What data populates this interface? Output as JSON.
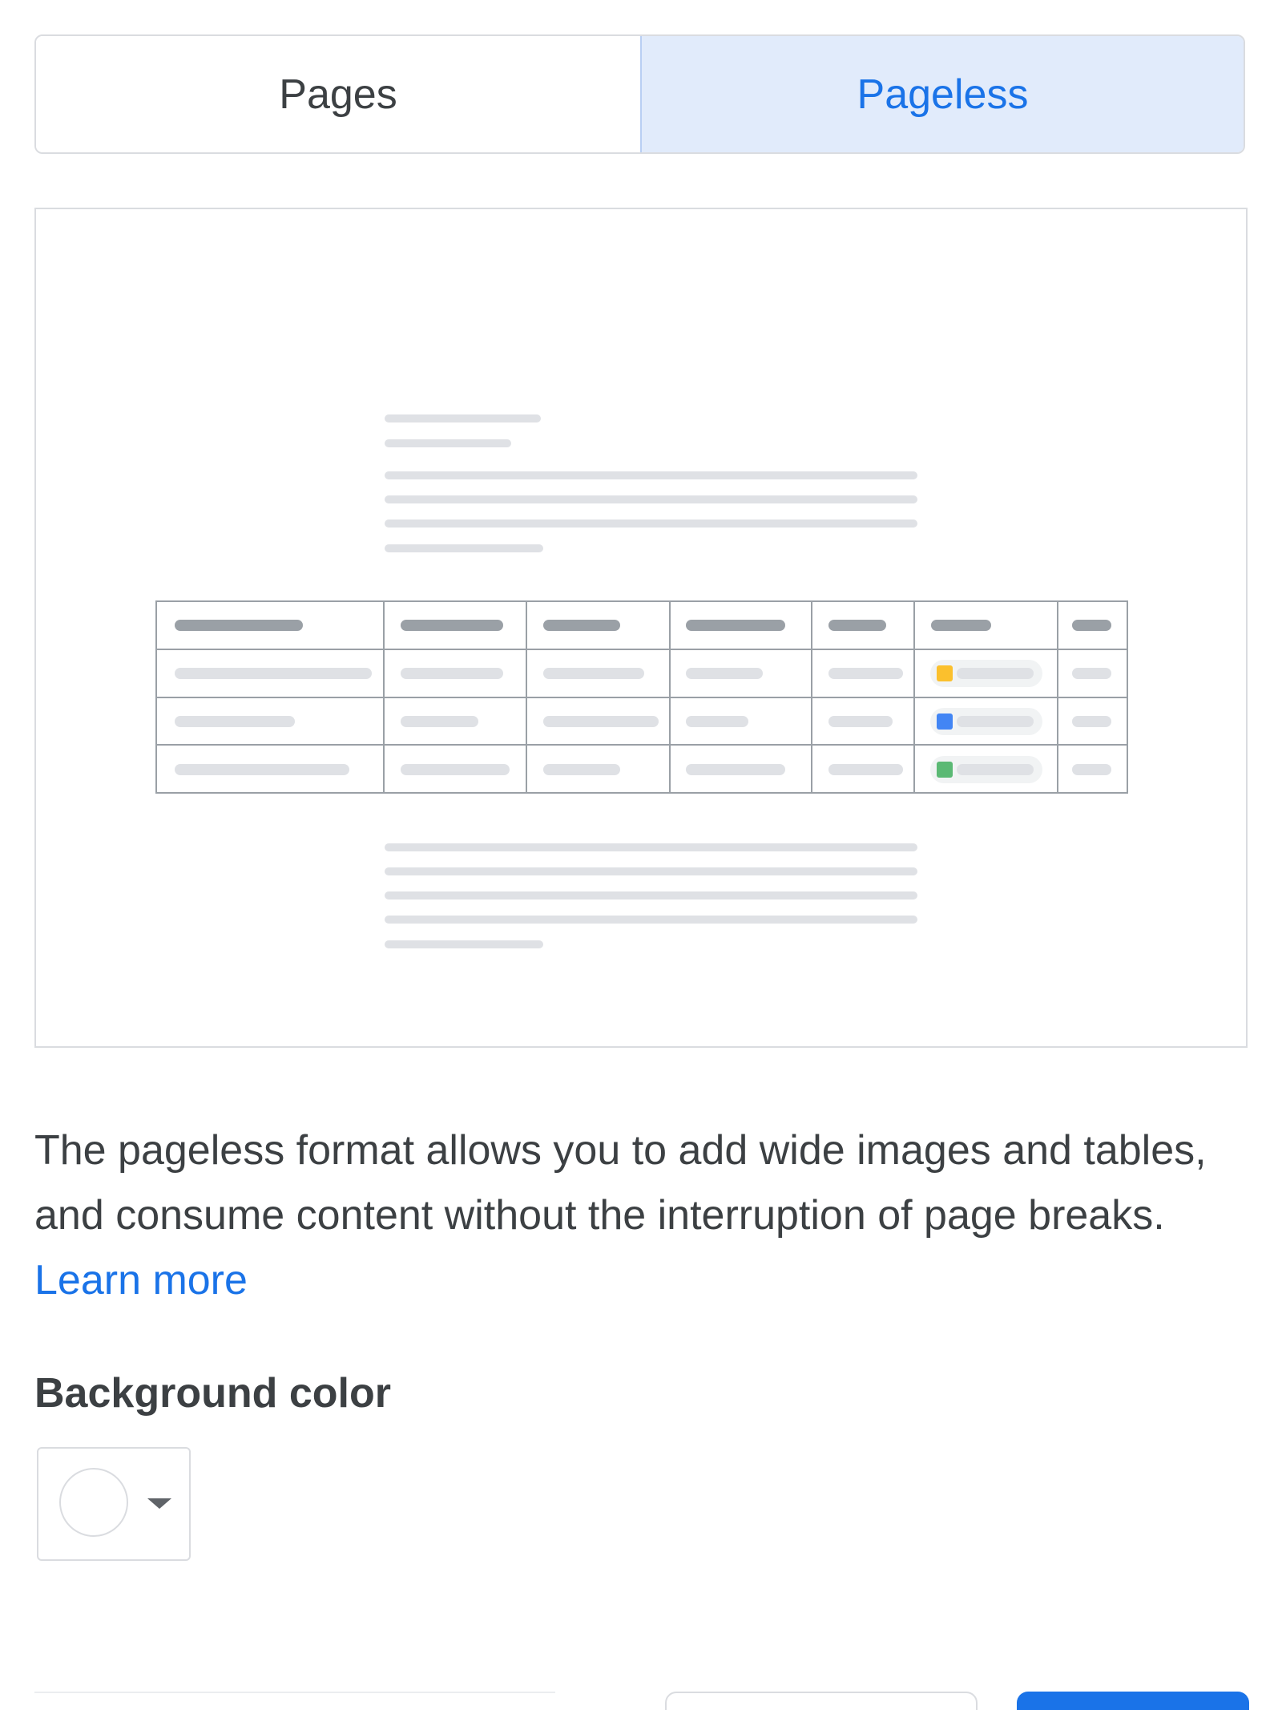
{
  "format_toggle": {
    "pages_label": "Pages",
    "pageless_label": "Pageless",
    "selected": "Pageless"
  },
  "preview": {
    "chip_colors": [
      "#fbc02d",
      "#4285f4",
      "#5bb974"
    ]
  },
  "description": {
    "text": "The pageless format allows you to add wide images and tables, and consume content without the interruption of page breaks.",
    "link_label": "Learn more"
  },
  "background_color": {
    "label": "Background color",
    "selected_color": "#ffffff"
  },
  "colors": {
    "accent": "#1a73e8",
    "accent_bg": "#e1ebfb",
    "border": "#dadce0",
    "text": "#3c4043"
  }
}
